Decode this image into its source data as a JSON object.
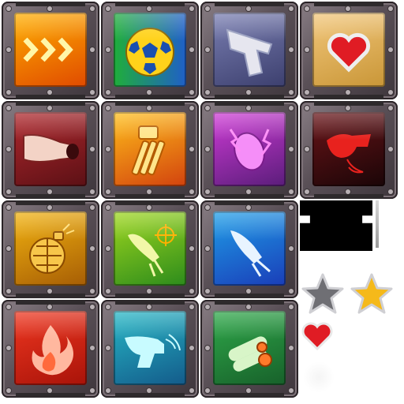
{
  "tiles": [
    {
      "id": "speed",
      "icon": "triple-chevron-icon",
      "colors": [
        "#ffb000",
        "#e04a00"
      ]
    },
    {
      "id": "soccer",
      "icon": "soccer-ball-icon",
      "colors": [
        "#1fae3a",
        "#1f5fc8"
      ]
    },
    {
      "id": "pistol",
      "icon": "pistol-icon",
      "colors": [
        "#7a7fb2",
        "#3c3f6e"
      ]
    },
    {
      "id": "health",
      "icon": "heart-icon",
      "colors": [
        "#f2c77b",
        "#c99637"
      ]
    },
    {
      "id": "cannon",
      "icon": "cannon-icon",
      "colors": [
        "#b0282d",
        "#5b1015"
      ]
    },
    {
      "id": "minigun",
      "icon": "gatling-gun-icon",
      "colors": [
        "#ffbf1a",
        "#d2420e"
      ]
    },
    {
      "id": "shock",
      "icon": "shock-egg-icon",
      "colors": [
        "#cf3bd6",
        "#5a1d7a"
      ]
    },
    {
      "id": "drill",
      "icon": "drill-horn-icon",
      "colors": [
        "#6a1418",
        "#1a0507"
      ]
    },
    {
      "id": "grenade",
      "icon": "grenade-icon",
      "colors": [
        "#f2b310",
        "#a65d05"
      ]
    },
    {
      "id": "homing",
      "icon": "homing-rocket-icon",
      "colors": [
        "#9fd71e",
        "#2c8b1c"
      ]
    },
    {
      "id": "rocket",
      "icon": "rocket-icon",
      "colors": [
        "#1f9fe8",
        "#1a3db8"
      ]
    },
    {
      "id": "fire",
      "icon": "flame-icon",
      "colors": [
        "#ef3720",
        "#a81309"
      ]
    },
    {
      "id": "freeze",
      "icon": "freeze-ray-icon",
      "colors": [
        "#27b8c6",
        "#135a8a"
      ]
    },
    {
      "id": "shells",
      "icon": "shell-cartridges-icon",
      "colors": [
        "#2fa94a",
        "#17602a"
      ]
    }
  ],
  "extras": {
    "star_empty": "star-empty-icon",
    "star_full": "star-filled-icon",
    "heart": "heart-icon",
    "star_color": "#f5b91a",
    "heart_color": "#e01c24"
  }
}
